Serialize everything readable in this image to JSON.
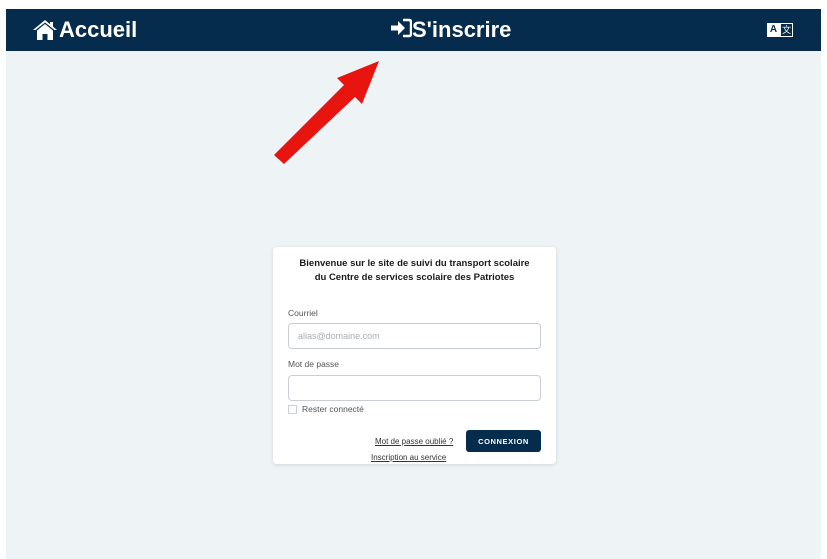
{
  "header": {
    "home_label": "Accueil",
    "home_icon": "home-icon",
    "signup_label": "S'inscrire",
    "signup_icon": "sign-in-icon",
    "language_icon": "translate-icon",
    "language_glyph_a": "A",
    "language_glyph_b": "文",
    "background_color": "#062c4d"
  },
  "annotation": {
    "arrow_color": "#e8140f"
  },
  "login": {
    "title_line1": "Bienvenue sur le site de suivi du transport scolaire",
    "title_line2": "du Centre de services scolaire des Patriotes",
    "email_label": "Courriel",
    "email_placeholder": "alias@domaine.com",
    "email_value": "",
    "password_label": "Mot de passe",
    "password_value": "",
    "remember_label": "Rester connecté",
    "remember_checked": false,
    "forgot_password_link": "Mot de passe oublié ?",
    "register_link": "Inscription au service",
    "submit_label": "CONNEXION"
  },
  "colors": {
    "page_background": "#eef3f6",
    "primary": "#062c4d",
    "card_background": "#ffffff"
  }
}
